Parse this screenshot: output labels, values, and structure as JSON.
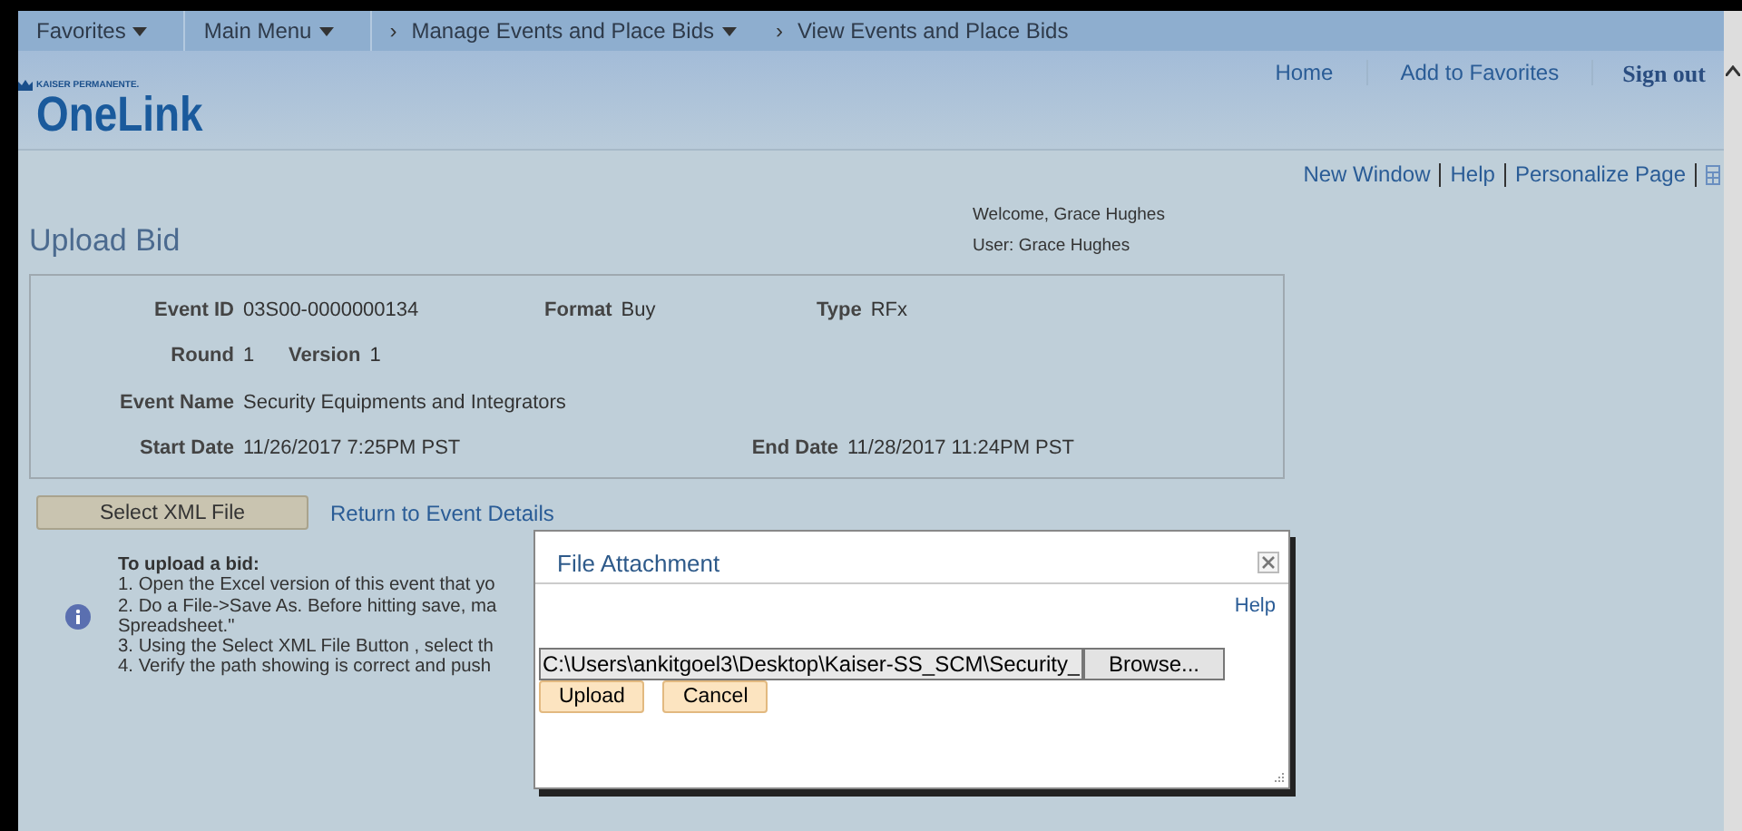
{
  "nav": {
    "items": [
      {
        "label": "Favorites",
        "caret": true
      },
      {
        "label": "Main Menu",
        "caret": true
      },
      {
        "prefix": "›",
        "label": "Manage Events and Place Bids",
        "caret": true
      },
      {
        "prefix": "›",
        "label": "View Events and Place Bids",
        "caret": false
      }
    ]
  },
  "header": {
    "brand_small": "KAISER PERMANENTE.",
    "brand": "OneLink",
    "links": [
      "Home",
      "Add to Favorites"
    ],
    "signout": "Sign out"
  },
  "page_links": [
    "New Window",
    "Help",
    "Personalize Page"
  ],
  "title": "Upload Bid",
  "welcome": "Welcome, Grace Hughes",
  "user": "User: Grace Hughes",
  "event": {
    "event_id": {
      "label": "Event ID",
      "value": "03S00-0000000134"
    },
    "format": {
      "label": "Format",
      "value": "Buy"
    },
    "type": {
      "label": "Type",
      "value": "RFx"
    },
    "round": {
      "label": "Round",
      "value": "1"
    },
    "version": {
      "label": "Version",
      "value": "1"
    },
    "event_name": {
      "label": "Event Name",
      "value": "Security Equipments and Integrators"
    },
    "start_date": {
      "label": "Start Date",
      "value": "11/26/2017  7:25PM PST"
    },
    "end_date": {
      "label": "End Date",
      "value": "11/28/2017 11:24PM PST"
    }
  },
  "select_button": "Select XML File",
  "return_link": "Return to Event Details",
  "instructions": {
    "heading": "To upload a bid:",
    "lines": [
      "1. Open the Excel version of this event that yo",
      "2. Do a File->Save As. Before hitting save, ma",
      "Spreadsheet.\"",
      "3. Using the Select XML File Button , select th",
      "4. Verify the path showing is correct and push"
    ]
  },
  "dialog": {
    "title": "File Attachment",
    "help": "Help",
    "file_value": "C:\\Users\\ankitgoel3\\Desktop\\Kaiser-SS_SCM\\Security_",
    "browse": "Browse...",
    "buttons": [
      "Upload",
      "Cancel"
    ]
  }
}
